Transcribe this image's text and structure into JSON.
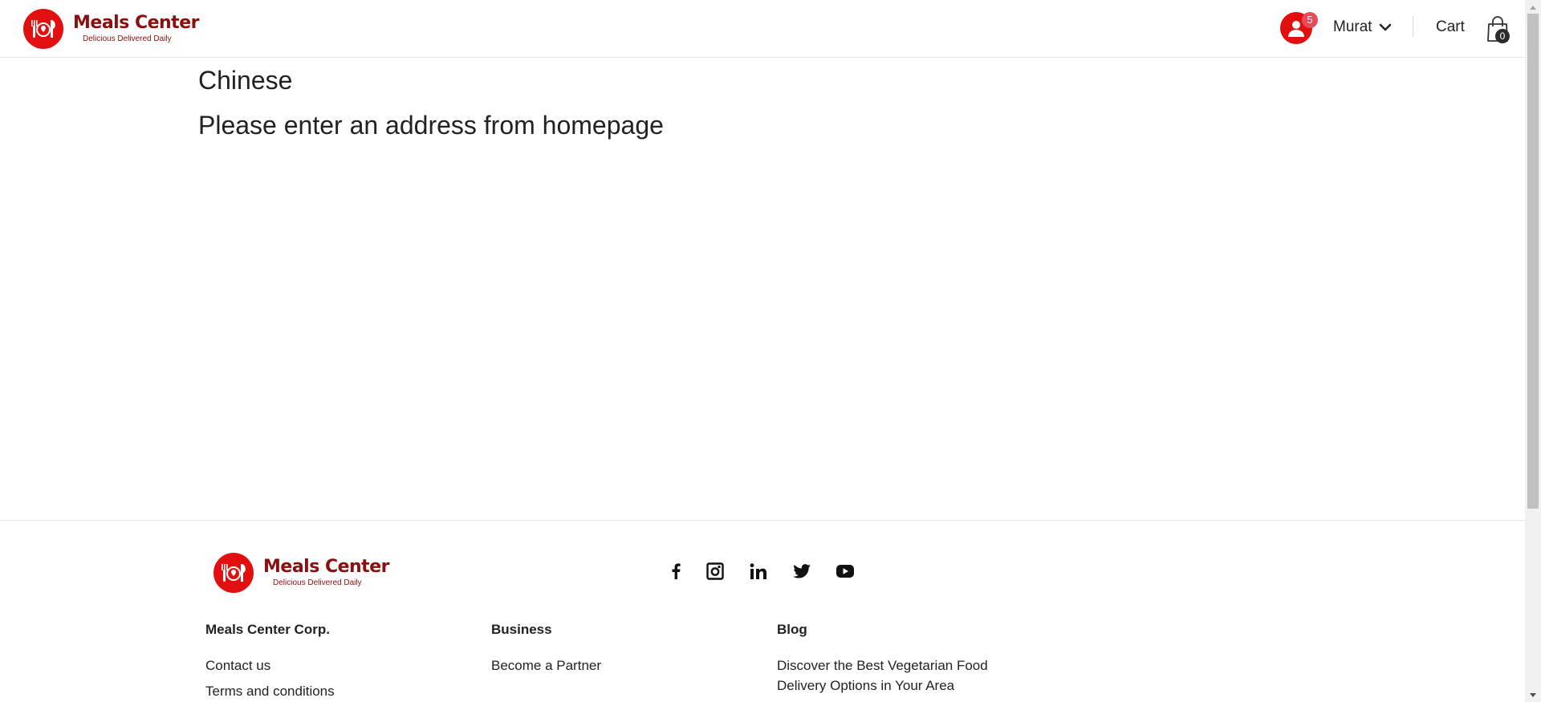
{
  "brand": {
    "name": "Meals Center",
    "tagline": "Delicious Delivered Daily",
    "primary_color": "#e10f0f",
    "text_color": "#8a0f0f"
  },
  "header": {
    "notifications_count": "5",
    "user_name": "Murat",
    "cart_label": "Cart",
    "cart_count": "0"
  },
  "main": {
    "title": "Chinese",
    "message": "Please enter an address from homepage"
  },
  "footer": {
    "social": [
      "facebook-icon",
      "instagram-icon",
      "linkedin-icon",
      "twitter-icon",
      "youtube-icon"
    ],
    "columns": [
      {
        "heading": "Meals Center Corp.",
        "links": [
          "Contact us",
          "Terms and conditions"
        ]
      },
      {
        "heading": "Business",
        "links": [
          "Become a Partner"
        ]
      },
      {
        "heading": "Blog",
        "links": [
          "Discover the Best Vegetarian Food Delivery Options in Your Area"
        ]
      }
    ]
  }
}
